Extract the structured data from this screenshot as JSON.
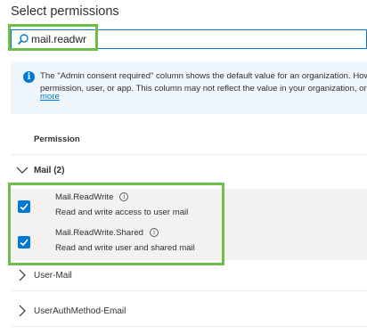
{
  "title": "Select permissions",
  "search": {
    "value": "mail.readwr",
    "placeholder": ""
  },
  "banner": {
    "line1": "The \"Admin consent required\" column shows the default value for an organization. Howe",
    "line2": "permission, user, or app. This column may not reflect the value in your organization, or i",
    "more": "more"
  },
  "table": {
    "column_header": "Permission"
  },
  "group": {
    "label": "Mail (2)",
    "expanded": true
  },
  "permissions": [
    {
      "name": "Mail.ReadWrite",
      "description": "Read and write access to user mail",
      "checked": true
    },
    {
      "name": "Mail.ReadWrite.Shared",
      "description": "Read and write user and shared mail",
      "checked": true
    }
  ],
  "other_groups": [
    {
      "label": "User-Mail"
    },
    {
      "label": "UserAuthMethod-Email"
    }
  ],
  "colors": {
    "accent": "#0078d4",
    "highlight": "#6dbf4b",
    "banner_bg": "#eff6fc",
    "row_bg": "#f3f2f1"
  }
}
